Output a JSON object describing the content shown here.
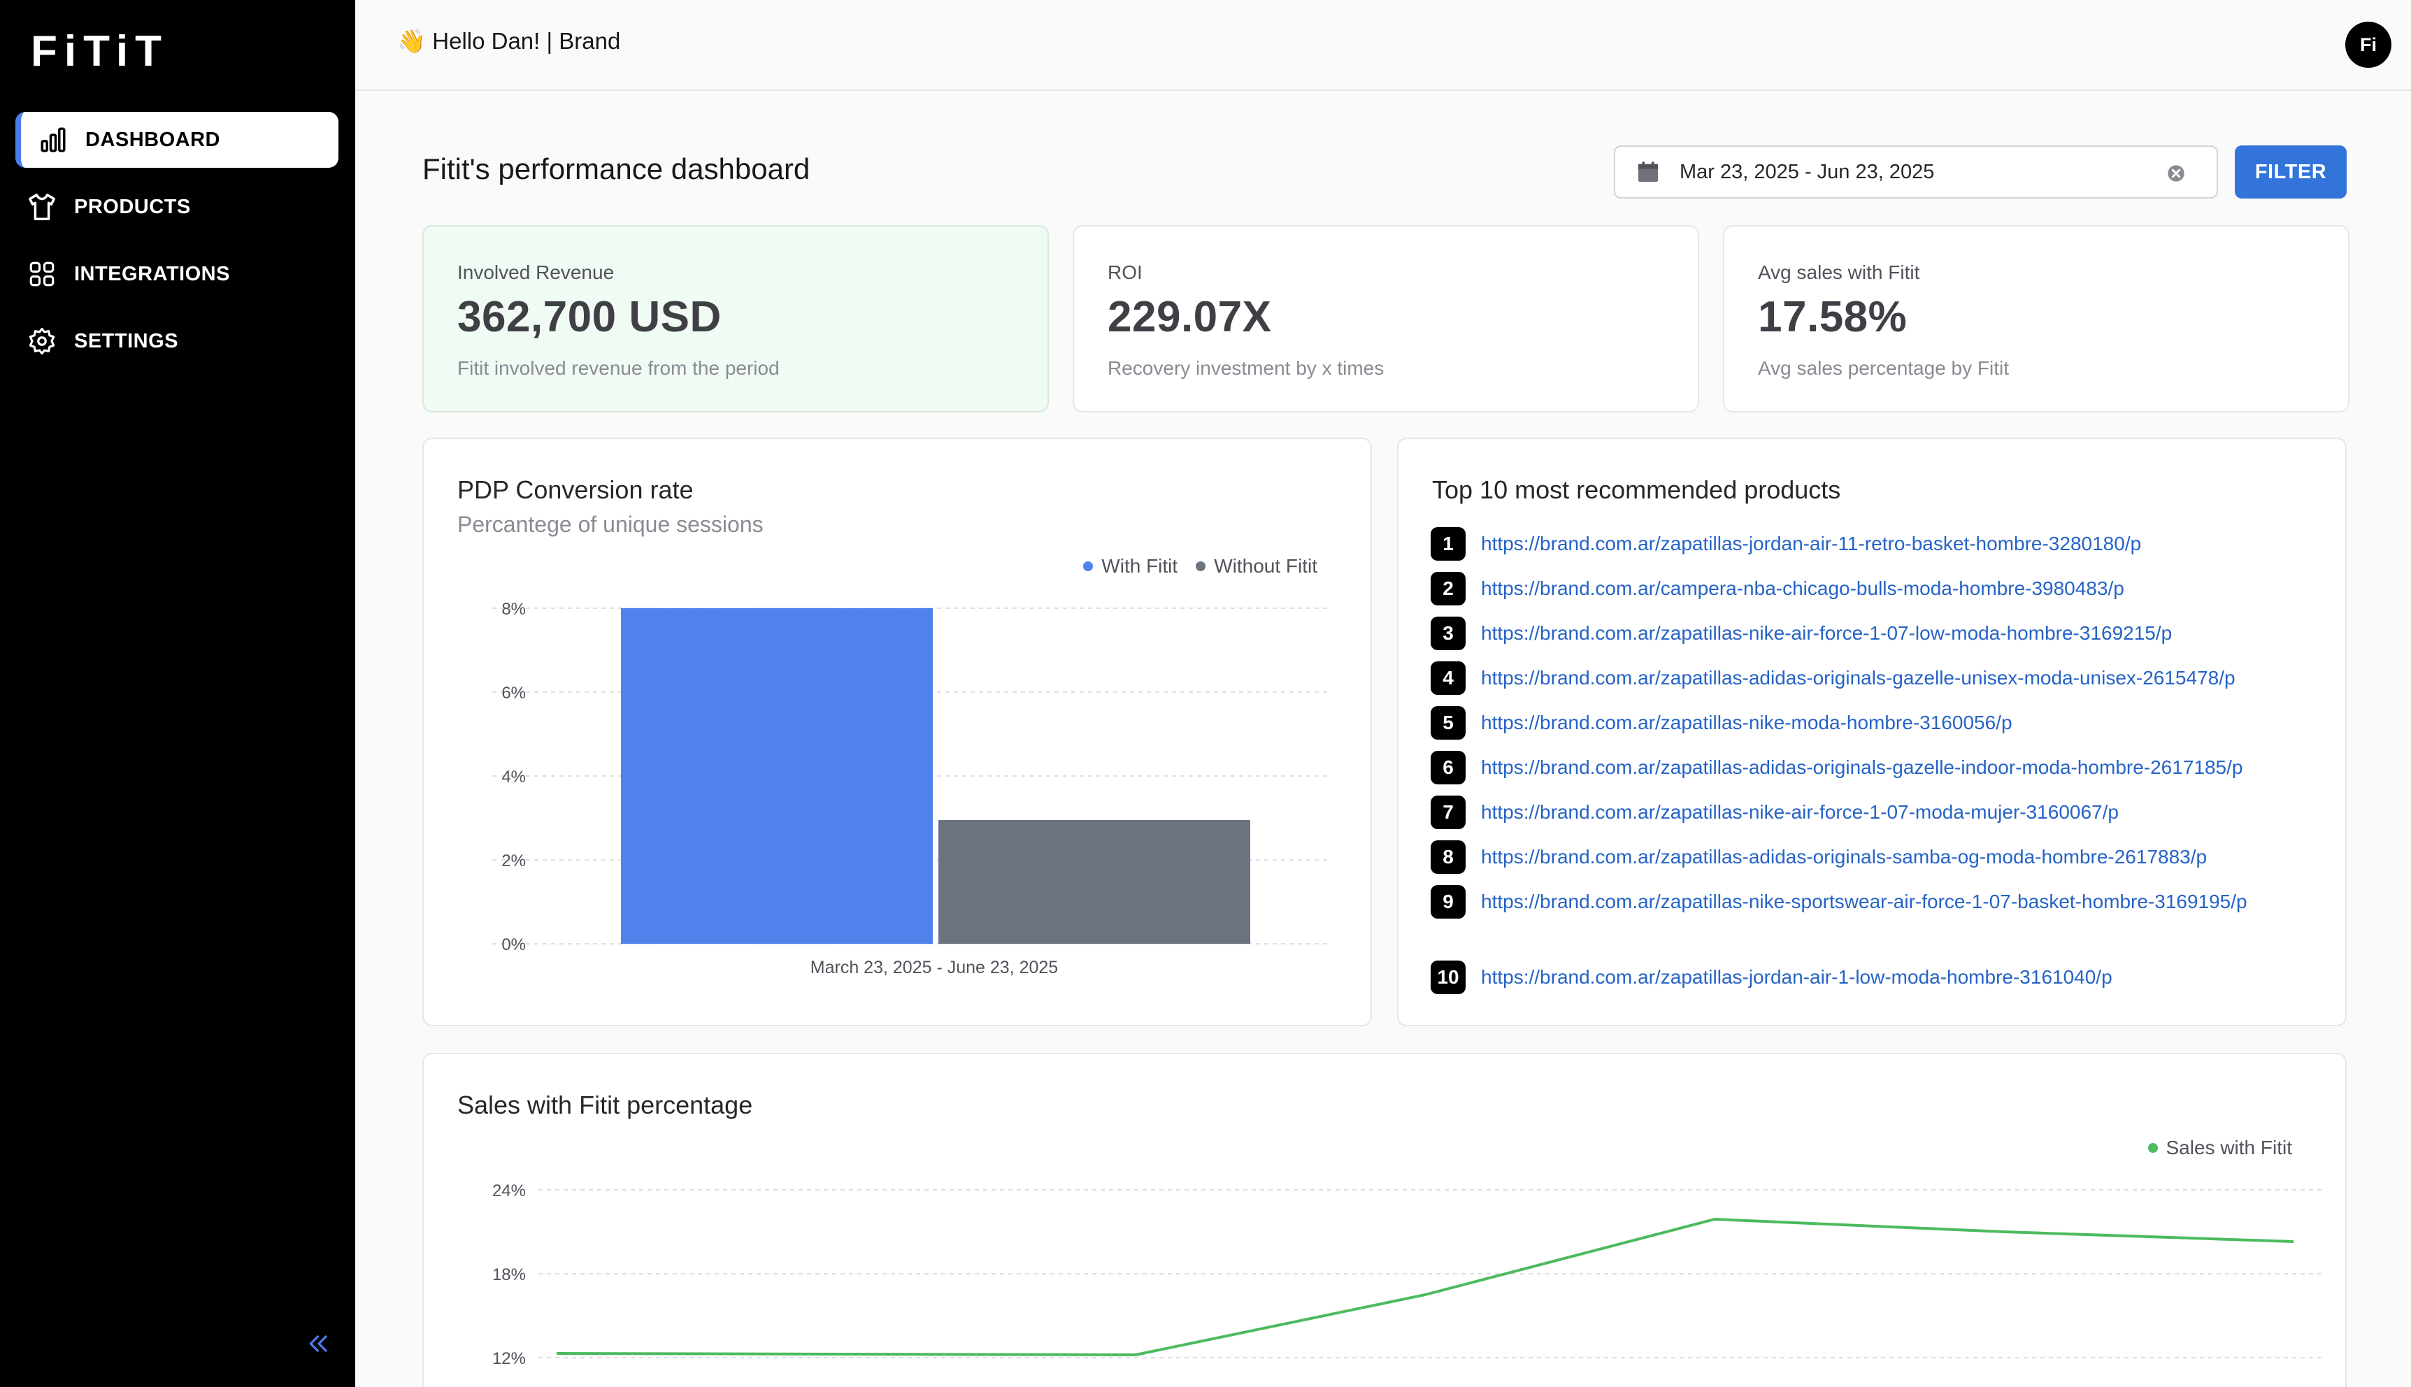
{
  "app": {
    "logo_text": "FiTiT",
    "avatar_text": "Fi"
  },
  "sidebar": {
    "items": [
      {
        "label": "DASHBOARD",
        "icon": "bar-chart-icon",
        "active": true
      },
      {
        "label": "PRODUCTS",
        "icon": "tshirt-icon",
        "active": false
      },
      {
        "label": "INTEGRATIONS",
        "icon": "grid-icon",
        "active": false
      },
      {
        "label": "SETTINGS",
        "icon": "gear-icon",
        "active": false
      }
    ],
    "collapse_icon": "double-chevron-left-icon"
  },
  "header": {
    "greeting": "👋 Hello Dan! | Brand"
  },
  "main": {
    "title": "Fitit's performance dashboard",
    "date_range": "Mar 23, 2025 - Jun 23, 2025",
    "filter_label": "FILTER"
  },
  "kpis": [
    {
      "label": "Involved Revenue",
      "value": "362,700 USD",
      "sub": "Fitit involved revenue from the period"
    },
    {
      "label": "ROI",
      "value": "229.07X",
      "sub": "Recovery investment by x times"
    },
    {
      "label": "Avg sales with Fitit",
      "value": "17.58%",
      "sub": "Avg sales percentage by Fitit"
    }
  ],
  "colors": {
    "accent": "#3274d9",
    "with_fitit": "#4f82ea",
    "without_fitit": "#6b7280",
    "sales_line": "#4cbb5e"
  },
  "pdp_card": {
    "title": "PDP Conversion rate",
    "subtitle": "Percantege of unique sessions"
  },
  "top_products": {
    "title": "Top 10 most recommended products",
    "items": [
      {
        "rank": "1",
        "url": "https://brand.com.ar/zapatillas-jordan-air-11-retro-basket-hombre-3280180/p"
      },
      {
        "rank": "2",
        "url": "https://brand.com.ar/campera-nba-chicago-bulls-moda-hombre-3980483/p"
      },
      {
        "rank": "3",
        "url": "https://brand.com.ar/zapatillas-nike-air-force-1-07-low-moda-hombre-3169215/p"
      },
      {
        "rank": "4",
        "url": "https://brand.com.ar/zapatillas-adidas-originals-gazelle-unisex-moda-unisex-2615478/p"
      },
      {
        "rank": "5",
        "url": "https://brand.com.ar/zapatillas-nike-moda-hombre-3160056/p"
      },
      {
        "rank": "6",
        "url": "https://brand.com.ar/zapatillas-adidas-originals-gazelle-indoor-moda-hombre-2617185/p"
      },
      {
        "rank": "7",
        "url": "https://brand.com.ar/zapatillas-nike-air-force-1-07-moda-mujer-3160067/p"
      },
      {
        "rank": "8",
        "url": "https://brand.com.ar/zapatillas-adidas-originals-samba-og-moda-hombre-2617883/p"
      },
      {
        "rank": "9",
        "url": "https://brand.com.ar/zapatillas-nike-sportswear-air-force-1-07-basket-hombre-3169195/p"
      },
      {
        "rank": "10",
        "url": "https://brand.com.ar/zapatillas-jordan-air-1-low-moda-hombre-3161040/p"
      }
    ]
  },
  "sales_card": {
    "title": "Sales with Fitit percentage"
  },
  "chart_data": [
    {
      "type": "bar",
      "categories": [
        "March 23, 2025 - June 23, 2025"
      ],
      "series": [
        {
          "name": "With Fitit",
          "values": [
            8.0
          ]
        },
        {
          "name": "Without Fitit",
          "values": [
            2.95
          ]
        }
      ],
      "yticks": [
        "0%",
        "2%",
        "4%",
        "6%",
        "8%"
      ],
      "ylim": [
        0,
        8
      ],
      "legend": "top-right",
      "grid": true
    },
    {
      "type": "line",
      "series": [
        {
          "name": "Sales with Fitit",
          "values": [
            12.3,
            12.25,
            12.2,
            16.5,
            21.9,
            21.0,
            20.3
          ]
        }
      ],
      "yticks": [
        "12%",
        "18%",
        "24%"
      ],
      "ylim": [
        12,
        24
      ],
      "legend": "top-right",
      "grid": true
    }
  ]
}
